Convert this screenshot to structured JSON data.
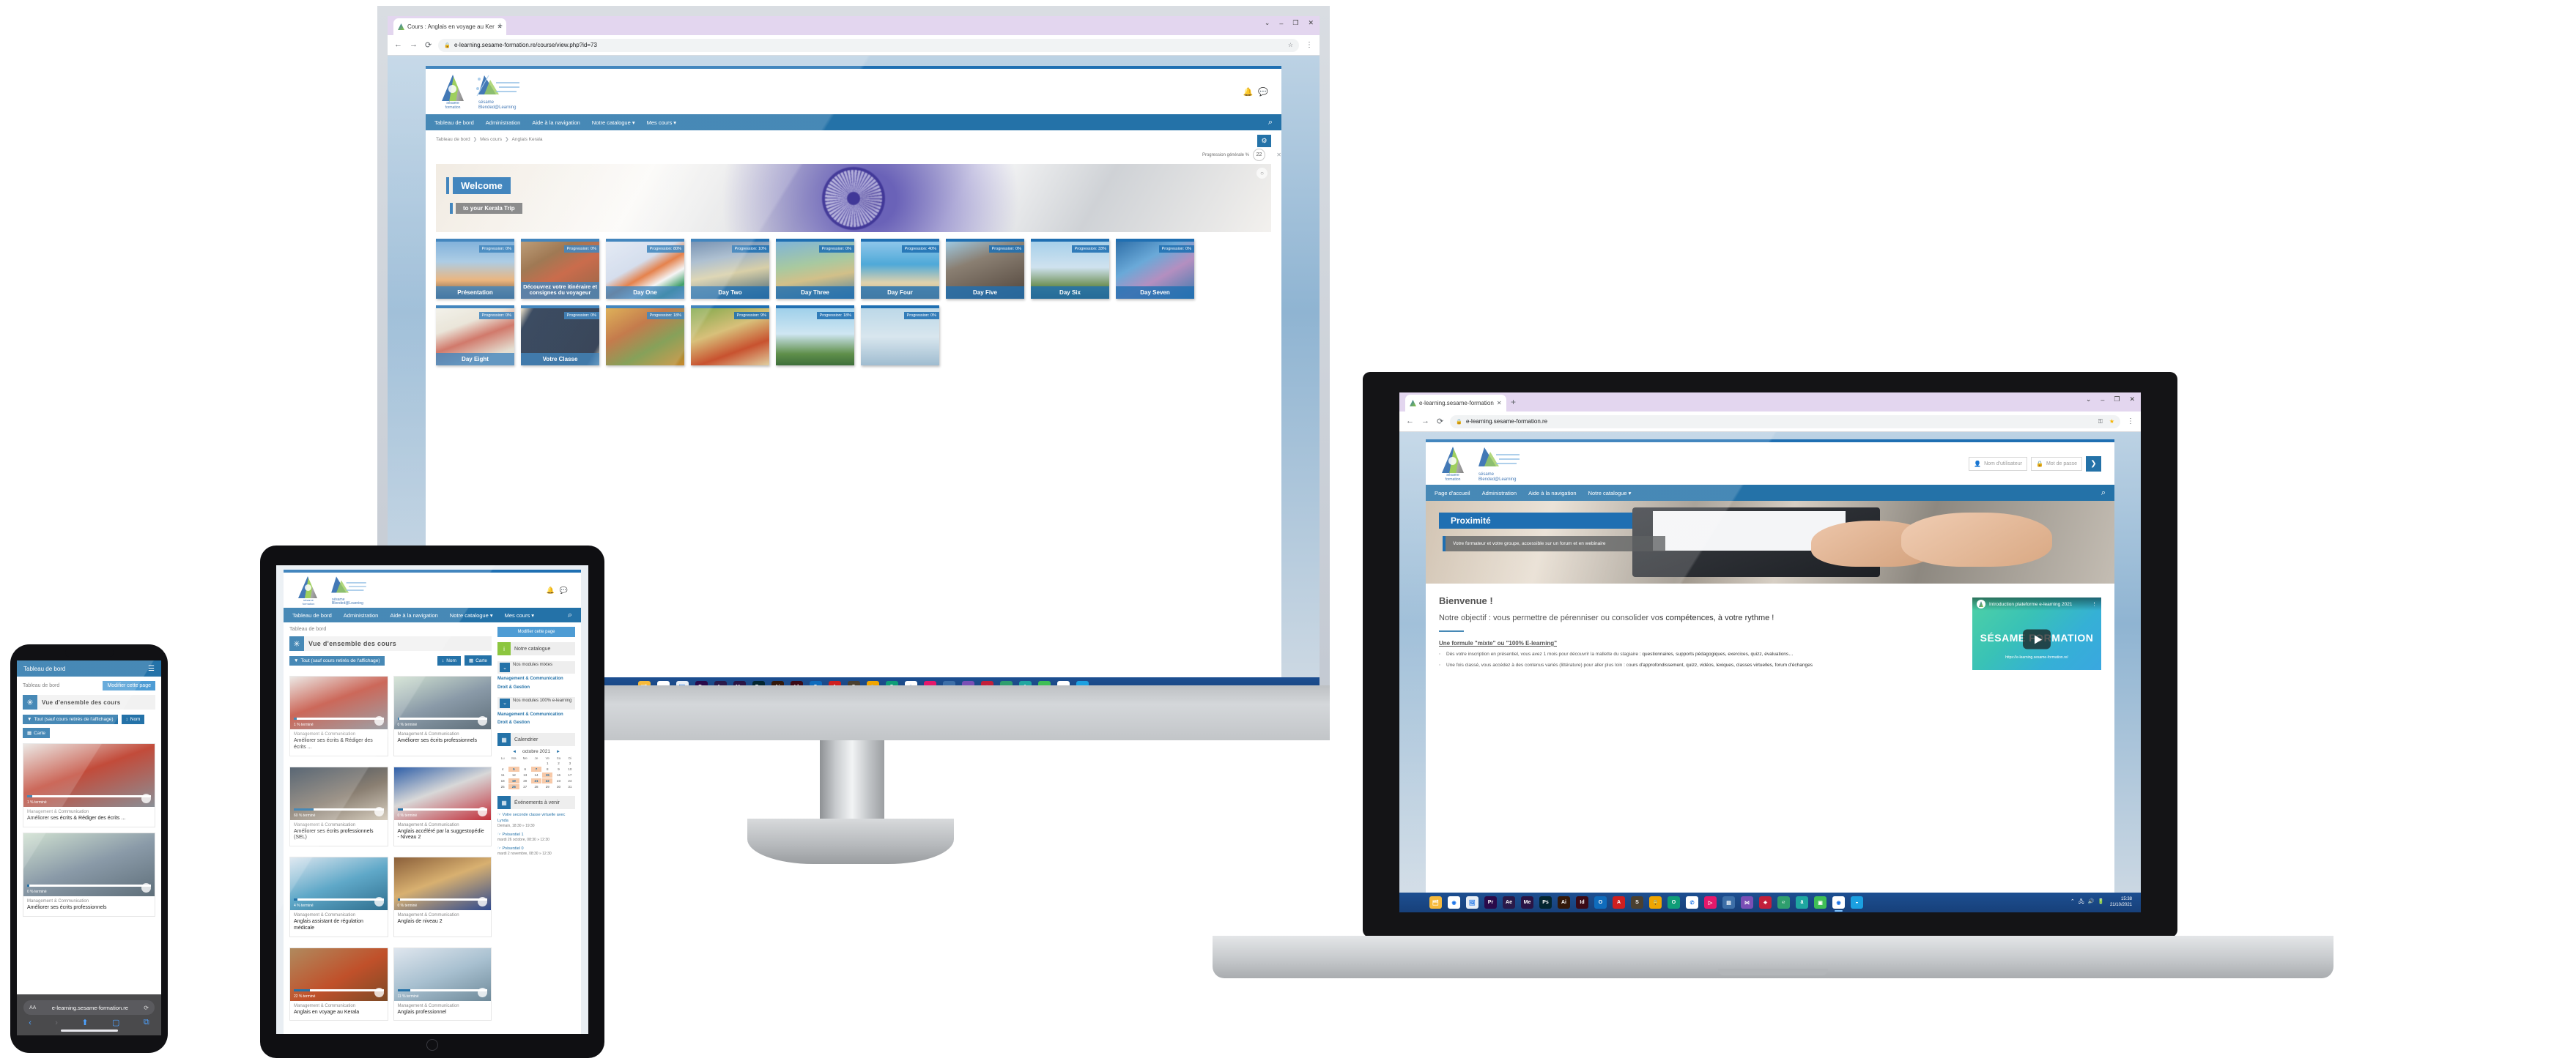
{
  "site": {
    "brand_primary": "#2472a8",
    "brand_dark": "#1f6fb2",
    "logo_main_label": "sésame",
    "logo_main_sub": "formation",
    "logo_second_label": "sésame",
    "logo_second_sub": "Blended@Learning"
  },
  "desktop": {
    "browser": {
      "tab_title": "Cours : Anglais en voyage au Ker",
      "tab_close": "✕",
      "new_tab": "+",
      "win_minimize": "–",
      "win_maximize": "❐",
      "win_close": "✕",
      "win_expand": "⌄",
      "back": "←",
      "forward": "→",
      "reload": "⟳",
      "lock_icon": "🔒",
      "url": "e-learning.sesame-formation.re/course/view.php?id=73",
      "star": "☆",
      "menu": "⋮"
    },
    "nav": [
      {
        "label": "Tableau de bord"
      },
      {
        "label": "Administration"
      },
      {
        "label": "Aide à la navigation"
      },
      {
        "label": "Notre catalogue ▾"
      },
      {
        "label": "Mes cours ▾"
      }
    ],
    "search_icon": "⌕",
    "header_icons": {
      "bell": "🔔",
      "chat": "💬"
    },
    "breadcrumb": [
      "Tableau de bord",
      "Mes cours",
      "Anglais Kerala"
    ],
    "breadcrumb_sep": "❯",
    "gear_icon": "⚙",
    "progress_label": "Progression générale %",
    "progress_value": "22",
    "close_icon": "✕",
    "banner": {
      "title": "Welcome",
      "subtitle": "to your Kerala Trip",
      "dismiss": "○"
    },
    "cards": [
      {
        "name": "Présentation",
        "progress": "Progression: 0%",
        "thumb": "sunset-crowd"
      },
      {
        "name": "Découvrez votre itinéraire et consignes du voyageur",
        "progress": "Progression: 0%",
        "thumb": "india-map"
      },
      {
        "name": "Day One",
        "progress": "Progression: 80%",
        "thumb": "india-flag"
      },
      {
        "name": "Day Two",
        "progress": "Progression: 10%",
        "thumb": "kerala-coast"
      },
      {
        "name": "Day Three",
        "progress": "Progression: 0%",
        "thumb": "temple-backwater"
      },
      {
        "name": "Day Four",
        "progress": "Progression: 40%",
        "thumb": "beach-lighthouse"
      },
      {
        "name": "Day Five",
        "progress": "Progression: 0%",
        "thumb": "palace"
      },
      {
        "name": "Day Six",
        "progress": "Progression: 33%",
        "thumb": "kalaripayattu"
      },
      {
        "name": "Day Seven",
        "progress": "Progression: 0%",
        "thumb": "kite"
      },
      {
        "name": "Day Eight",
        "progress": "Progression: 0%",
        "thumb": "update-day"
      },
      {
        "name": "Votre Classe",
        "progress": "Progression: 0%",
        "thumb": "classe-dark"
      },
      {
        "name": "",
        "progress": "Progression: 18%",
        "thumb": "textile"
      },
      {
        "name": "",
        "progress": "Progression: 9%",
        "thumb": "food"
      },
      {
        "name": "",
        "progress": "Progression: 18%",
        "thumb": "palm-sky"
      },
      {
        "name": "",
        "progress": "Progression: 0%",
        "thumb": "mist"
      }
    ],
    "taskbar": [
      {
        "name": "start-windows",
        "glyph": "",
        "color": "#0b7ec6"
      },
      {
        "name": "file-explorer",
        "glyph": "🗂",
        "color": "#f6b93b"
      },
      {
        "name": "google-chrome",
        "glyph": "◉",
        "color": "#ffffff"
      },
      {
        "name": "photos",
        "glyph": "🖼",
        "color": "#e8eef5"
      },
      {
        "name": "adobe-premiere-pro",
        "glyph": "Pr",
        "color": "#2a0a4a"
      },
      {
        "name": "adobe-after-effects",
        "glyph": "Ae",
        "color": "#2a1a4a"
      },
      {
        "name": "adobe-media-encoder",
        "glyph": "Me",
        "color": "#2a1444"
      },
      {
        "name": "adobe-photoshop",
        "glyph": "Ps",
        "color": "#03252f"
      },
      {
        "name": "adobe-illustrator",
        "glyph": "Ai",
        "color": "#33180a"
      },
      {
        "name": "adobe-indesign",
        "glyph": "Id",
        "color": "#3b0a16"
      },
      {
        "name": "microsoft-outlook",
        "glyph": "O",
        "color": "#0f6cbd"
      },
      {
        "name": "adobe-acrobat",
        "glyph": "A",
        "color": "#cf1f1f"
      },
      {
        "name": "sublime-text",
        "glyph": "S",
        "color": "#4a4030"
      },
      {
        "name": "locked-app",
        "glyph": "🔒",
        "color": "#f0a500"
      },
      {
        "name": "opera",
        "glyph": "O",
        "color": "#0f9d78"
      },
      {
        "name": "whatsapp",
        "glyph": "✆",
        "color": "#ffffff"
      },
      {
        "name": "media-player",
        "glyph": "▷",
        "color": "#e5186b"
      },
      {
        "name": "remote-desktop",
        "glyph": "▤",
        "color": "#3d6fa8"
      },
      {
        "name": "visual-studio",
        "glyph": "⋈",
        "color": "#7a4fb5"
      },
      {
        "name": "snowflake-app",
        "glyph": "✷",
        "color": "#c21f3a"
      },
      {
        "name": "curl-app",
        "glyph": "℮",
        "color": "#2f9e6e"
      },
      {
        "name": "teal-app",
        "glyph": "ā",
        "color": "#1fa7a0"
      },
      {
        "name": "messaging-app",
        "glyph": "▣",
        "color": "#3fbf56"
      },
      {
        "name": "google-chrome-active",
        "glyph": "◉",
        "color": "#ffffff"
      },
      {
        "name": "microsoft-edge",
        "glyph": "◒",
        "color": "#1ba0e1"
      }
    ]
  },
  "tablet": {
    "nav": [
      {
        "label": "Tableau de bord"
      },
      {
        "label": "Administration"
      },
      {
        "label": "Aide à la navigation"
      },
      {
        "label": "Notre catalogue ▾"
      },
      {
        "label": "Mes cours ▾"
      }
    ],
    "search_icon": "⌕",
    "breadcrumb": "Tableau de bord",
    "edit_page_button": "Modifier cette page",
    "page_title": "Vue d'ensemble des cours",
    "asterisk_icon": "✳",
    "filters": [
      {
        "label": "Tout (sauf cours retirés de l'affichage)",
        "icon": "▼"
      },
      {
        "label": "Nom",
        "icon": "↕"
      },
      {
        "label": "Carte",
        "icon": "▦"
      }
    ],
    "courses": [
      {
        "category": "Management & Communication",
        "name": "Améliorer ses écrits & Rédiger des écrits ...",
        "pct": "1 % terminé",
        "bar": 3
      },
      {
        "category": "Management & Communication",
        "name": "Améliorer ses écrits professionnels",
        "pct": "0 % terminé",
        "bar": 2
      },
      {
        "category": "Management & Communication",
        "name": "Améliorer ses écrits professionnels (SEL)",
        "pct": "60 % terminé",
        "bar": 22
      },
      {
        "category": "Management & Communication",
        "name": "Anglais accéléré par la suggestopédie - Niveau 2",
        "pct": "0 % terminé",
        "bar": 6
      },
      {
        "category": "Management & Communication",
        "name": "Anglais assistant de régulation médicale",
        "pct": "4 % terminé",
        "bar": 4
      },
      {
        "category": "Management & Communication",
        "name": "Anglais de niveau 2",
        "pct": "0 % terminé",
        "bar": 3
      },
      {
        "category": "Management & Communication",
        "name": "Anglais en voyage au Kerala",
        "pct": "22 % terminé",
        "bar": 18
      },
      {
        "category": "Management & Communication",
        "name": "Anglais professionnel",
        "pct": "11 % terminé",
        "bar": 14
      }
    ],
    "sidebar": {
      "catalogue_label": "Notre catalogue",
      "catalogue_icon": "i",
      "blocks": [
        {
          "title": "Nos modules mixtes",
          "icon": "⌄",
          "links": [
            "Management & Communication",
            "Droit & Gestion"
          ]
        },
        {
          "title": "Nos modules 100% e-learning",
          "icon": "⌄",
          "links": [
            "Management & Communication",
            "Droit & Gestion"
          ]
        }
      ],
      "calendar": {
        "title": "Calendrier",
        "icon": "📅",
        "month": "octobre 2021",
        "prev": "◄",
        "next": "►",
        "weekdays": [
          "Lu",
          "Ma",
          "Me",
          "Je",
          "Ve",
          "Sa",
          "Di"
        ],
        "weeks": [
          [
            "",
            "",
            "",
            "",
            "1",
            "2",
            "3"
          ],
          [
            "4",
            "5",
            "6",
            "7",
            "8",
            "9",
            "10"
          ],
          [
            "11",
            "12",
            "13",
            "14",
            "15",
            "16",
            "17"
          ],
          [
            "18",
            "19",
            "20",
            "21",
            "22",
            "23",
            "24"
          ],
          [
            "25",
            "26",
            "27",
            "28",
            "29",
            "30",
            "31"
          ]
        ],
        "highlighted": [
          "5",
          "7",
          "15",
          "19",
          "21",
          "22",
          "26"
        ]
      },
      "events": {
        "title": "Événements à venir",
        "icon": "📅",
        "items": [
          {
            "name": "Votre seconde classe virtuelle avec Lynda",
            "when": "Demain, 18:30 » 19:30"
          },
          {
            "name": "Présentiel 1",
            "when": "mardi 26 octobre, 08:30 » 12:30"
          },
          {
            "name": "Présentiel 0",
            "when": "mardi 2 novembre, 08:30 » 12:30"
          }
        ]
      }
    }
  },
  "phone": {
    "nav_label": "Tableau de bord",
    "burger_icon": "☰",
    "breadcrumb": "Tableau de bord",
    "edit_page_button": "Modifier cette page",
    "asterisk_icon": "✳",
    "page_title": "Vue d'ensemble des cours",
    "filters": [
      {
        "label": "Tout (sauf cours retirés de l'affichage)",
        "icon": "▼"
      },
      {
        "label": "Nom",
        "icon": "↕"
      },
      {
        "label": "Carte",
        "icon": "▦"
      }
    ],
    "courses": [
      {
        "category": "Management & Communication",
        "name": "Améliorer ses écrits & Rédiger des écrits ...",
        "pct": "1 % terminé",
        "bar": 4
      },
      {
        "category": "Management & Communication",
        "name": "Améliorer ses écrits professionnels",
        "pct": "0 % terminé",
        "bar": 2
      }
    ],
    "safari": {
      "aa_icon": "AA",
      "lock_icon": "🔒",
      "url": "e-learning.sesame-formation.re",
      "reload_icon": "⟳",
      "back_icon": "‹",
      "forward_icon": "›",
      "share_icon": "⬆",
      "bookmarks_icon": "▢",
      "tabs_icon": "⧉"
    }
  },
  "laptop": {
    "browser": {
      "tab_title": "e-learning.sesame-formation",
      "tab_close": "✕",
      "new_tab": "+",
      "win_expand": "⌄",
      "win_minimize": "–",
      "win_maximize": "❐",
      "win_close": "✕",
      "back": "←",
      "forward": "→",
      "reload": "⟳",
      "lock_icon": "🔒",
      "url": "e-learning.sesame-formation.re",
      "key_icon": "⚿",
      "star": "★",
      "menu": "⋮"
    },
    "login": {
      "username_placeholder": "Nom d'utilisateur",
      "password_placeholder": "Mot de passe",
      "user_icon": "👤",
      "lock_icon": "🔒",
      "submit_icon": "❯"
    },
    "nav": [
      {
        "label": "Page d'accueil"
      },
      {
        "label": "Administration"
      },
      {
        "label": "Aide à la navigation"
      },
      {
        "label": "Notre catalogue ▾"
      }
    ],
    "search_icon": "⌕",
    "hero": {
      "title": "Proximité",
      "subtitle": "Votre formateur et votre groupe, accessible sur un forum et en webinaire"
    },
    "content": {
      "heading": "Bienvenue !",
      "paragraph": "Notre objectif : vous permettre de pérenniser ou consolider vos compétences, à votre rythme !",
      "subheading": "Une formule \"mixte\" ou \"100% E-learning\"",
      "bullets": [
        "Dès votre inscription en présentiel, vous avez 1 mois pour découvrir la mallette du stagiaire : questionnaires, supports pédagogiques, exercices, quizz, évaluations…",
        "Une fois classé, vous accédez à des contenus variés (littérature) pour aller plus loin : cours d'approfondissement, quizz, vidéos, lexiques, classes virtuelles, forum d'échanges"
      ]
    },
    "video": {
      "title": "Introduction plateforme e-learning 2021",
      "brand": "SÉSAME FORMATION",
      "url": "https://e-learning.sesame-formation.re/",
      "kebab": "⋮",
      "play_icon": "▶"
    },
    "taskbar": [
      {
        "name": "start-windows",
        "glyph": "",
        "color": "#0b7ec6"
      },
      {
        "name": "file-explorer",
        "glyph": "🗂",
        "color": "#f6b93b"
      },
      {
        "name": "google-chrome",
        "glyph": "◉",
        "color": "#ffffff"
      },
      {
        "name": "photos",
        "glyph": "🖼",
        "color": "#e8eef5"
      },
      {
        "name": "adobe-premiere-pro",
        "glyph": "Pr",
        "color": "#2a0a4a"
      },
      {
        "name": "adobe-after-effects",
        "glyph": "Ae",
        "color": "#2a1a4a"
      },
      {
        "name": "adobe-media-encoder",
        "glyph": "Me",
        "color": "#2a1444"
      },
      {
        "name": "adobe-photoshop",
        "glyph": "Ps",
        "color": "#03252f"
      },
      {
        "name": "adobe-illustrator",
        "glyph": "Ai",
        "color": "#33180a"
      },
      {
        "name": "adobe-indesign",
        "glyph": "Id",
        "color": "#3b0a16"
      },
      {
        "name": "microsoft-outlook",
        "glyph": "O",
        "color": "#0f6cbd"
      },
      {
        "name": "adobe-acrobat",
        "glyph": "A",
        "color": "#cf1f1f"
      },
      {
        "name": "sublime-text",
        "glyph": "S",
        "color": "#4a4030"
      },
      {
        "name": "locked-app",
        "glyph": "🔒",
        "color": "#f0a500"
      },
      {
        "name": "opera",
        "glyph": "O",
        "color": "#0f9d78"
      },
      {
        "name": "whatsapp",
        "glyph": "✆",
        "color": "#ffffff"
      },
      {
        "name": "media-player",
        "glyph": "▷",
        "color": "#e5186b"
      },
      {
        "name": "remote-desktop",
        "glyph": "▤",
        "color": "#3d6fa8"
      },
      {
        "name": "visual-studio",
        "glyph": "⋈",
        "color": "#7a4fb5"
      },
      {
        "name": "snowflake-app",
        "glyph": "✷",
        "color": "#c21f3a"
      },
      {
        "name": "curl-app",
        "glyph": "℮",
        "color": "#2f9e6e"
      },
      {
        "name": "teal-app",
        "glyph": "ā",
        "color": "#1fa7a0"
      },
      {
        "name": "messaging-app",
        "glyph": "▣",
        "color": "#3fbf56"
      },
      {
        "name": "google-chrome-active",
        "glyph": "◉",
        "color": "#ffffff"
      },
      {
        "name": "microsoft-edge",
        "glyph": "◒",
        "color": "#1ba0e1"
      }
    ],
    "system_tray": {
      "chevron": "⌃",
      "network_icon": "🖧",
      "volume_icon": "🔊",
      "battery_icon": "🔋",
      "time": "15:38",
      "date": "21/10/2021"
    }
  }
}
